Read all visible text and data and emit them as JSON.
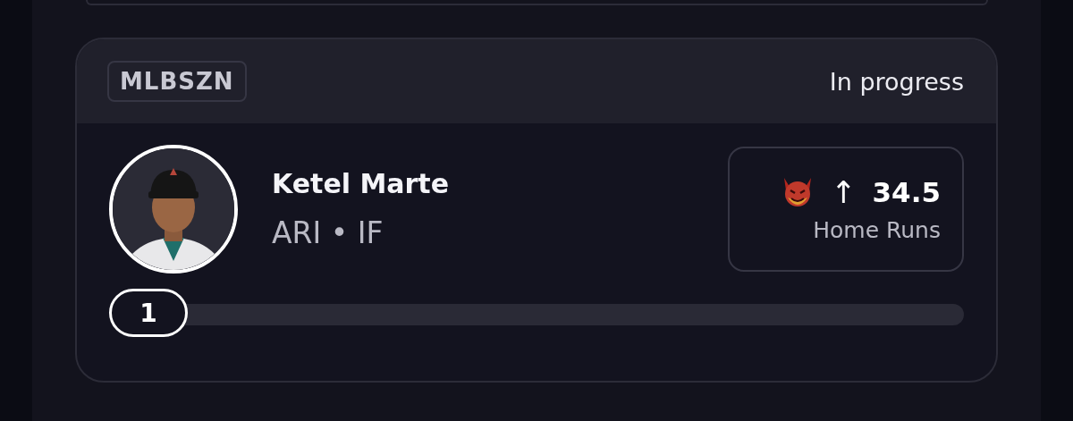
{
  "card": {
    "tag": "MLBSZN",
    "status": "In progress",
    "player": {
      "name": "Ketel Marte",
      "team_position": "ARI • IF"
    },
    "pick": {
      "arrow": "↑",
      "line": "34.5",
      "stat": "Home Runs"
    },
    "progress": {
      "count": "1",
      "level": 0
    }
  }
}
